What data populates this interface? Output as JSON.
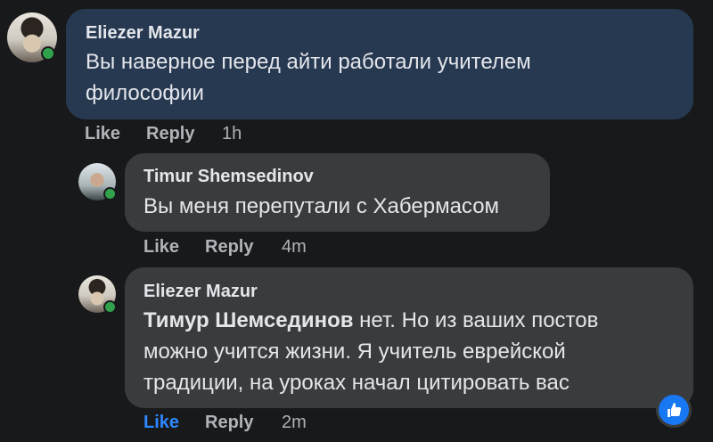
{
  "comments": [
    {
      "author": "Eliezer Mazur",
      "text": "Вы наверное перед айти работали учителем философии",
      "actions": {
        "like": "Like",
        "reply": "Reply",
        "time": "1h"
      }
    },
    {
      "author": "Timur Shemsedinov",
      "text": "Вы меня перепутали с Хабермасом",
      "actions": {
        "like": "Like",
        "reply": "Reply",
        "time": "4m"
      }
    },
    {
      "author": "Eliezer Mazur",
      "mention": "Тимур Шемседиnov",
      "text_lines": [
        " нет. Но из ваших постов",
        "можно учится жизни. Я учитель еврейской",
        "традиции, на уроках начал цитировать вас"
      ],
      "actions": {
        "like": "Like",
        "reply": "Reply",
        "time": "2m"
      },
      "reaction": "like-reaction-icon"
    }
  ]
}
